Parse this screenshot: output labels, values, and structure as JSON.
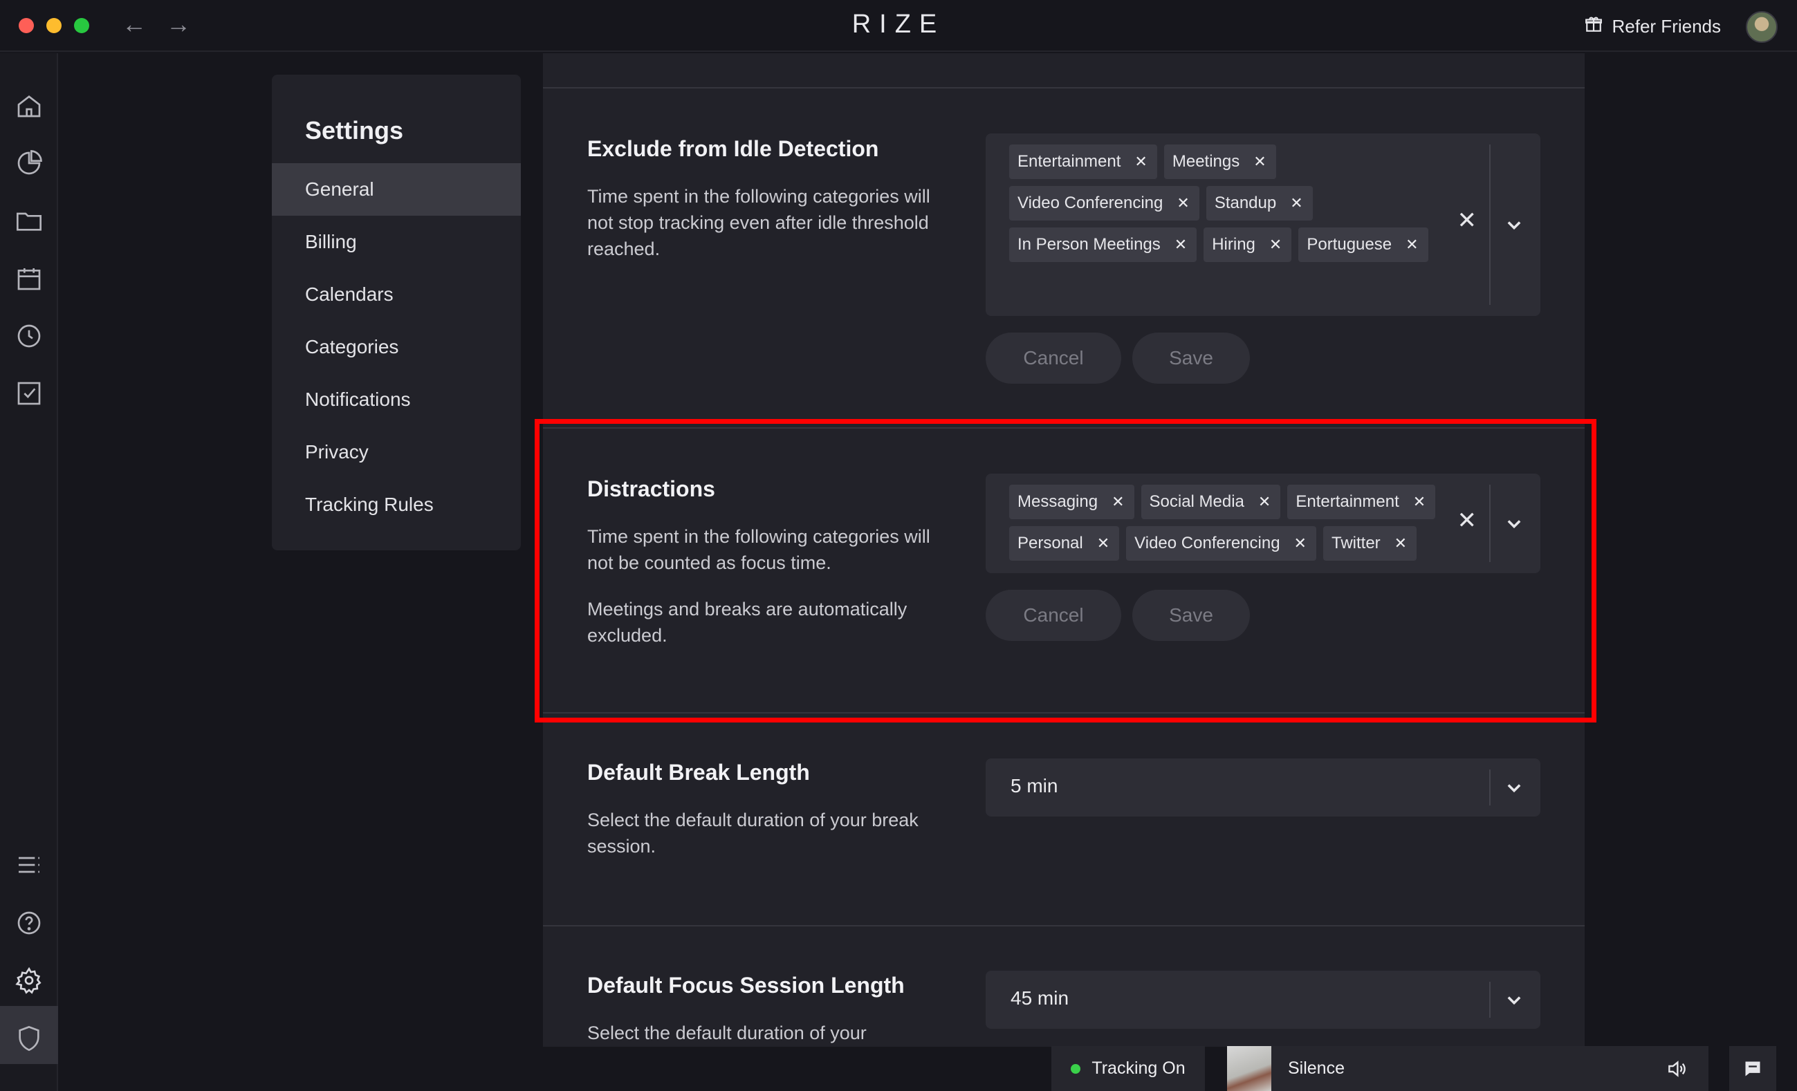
{
  "titlebar": {
    "back_icon": "arrow-left-icon",
    "forward_icon": "arrow-right-icon",
    "app_title": "RIZE",
    "refer_label": "Refer Friends",
    "refer_icon": "gift-icon"
  },
  "rail": {
    "top_icons": [
      "home-icon",
      "pie-chart-icon",
      "folder-icon",
      "calendar-icon",
      "clock-icon",
      "checkbox-icon"
    ],
    "bottom_icons": [
      "list-icon",
      "help-icon",
      "gear-icon",
      "shield-icon"
    ],
    "active": "gear-icon"
  },
  "settings": {
    "heading": "Settings",
    "items": [
      {
        "label": "General",
        "active": true
      },
      {
        "label": "Billing"
      },
      {
        "label": "Calendars"
      },
      {
        "label": "Categories"
      },
      {
        "label": "Notifications"
      },
      {
        "label": "Privacy"
      },
      {
        "label": "Tracking Rules"
      }
    ]
  },
  "idle": {
    "title": "Exclude from Idle Detection",
    "description": "Time spent in the following categories will not stop tracking even after idle threshold reached.",
    "chips": [
      "Entertainment",
      "Meetings",
      "Video Conferencing",
      "Standup",
      "In Person Meetings",
      "Hiring",
      "Portuguese"
    ],
    "cancel_label": "Cancel",
    "save_label": "Save"
  },
  "distractions": {
    "title": "Distractions",
    "description": "Time spent in the following categories will not be counted as focus time.",
    "note": "Meetings and breaks are automatically excluded.",
    "chips": [
      "Messaging",
      "Social Media",
      "Entertainment",
      "Personal",
      "Video Conferencing",
      "Twitter"
    ],
    "cancel_label": "Cancel",
    "save_label": "Save"
  },
  "break_length": {
    "title": "Default Break Length",
    "description": "Select the default duration of your break session.",
    "value": "5 min"
  },
  "focus_length": {
    "title": "Default Focus Session Length",
    "description": "Select the default duration of your",
    "value": "45 min"
  },
  "bottom_bar": {
    "tracking_label": "Tracking On",
    "tracking_color": "#3ad14a",
    "track_name": "Silence",
    "speaker_icon": "speaker-icon",
    "chat_icon": "chat-icon"
  },
  "colors": {
    "highlight": "#ff0000",
    "panel_bg": "#222229",
    "app_bg": "#16161c"
  }
}
